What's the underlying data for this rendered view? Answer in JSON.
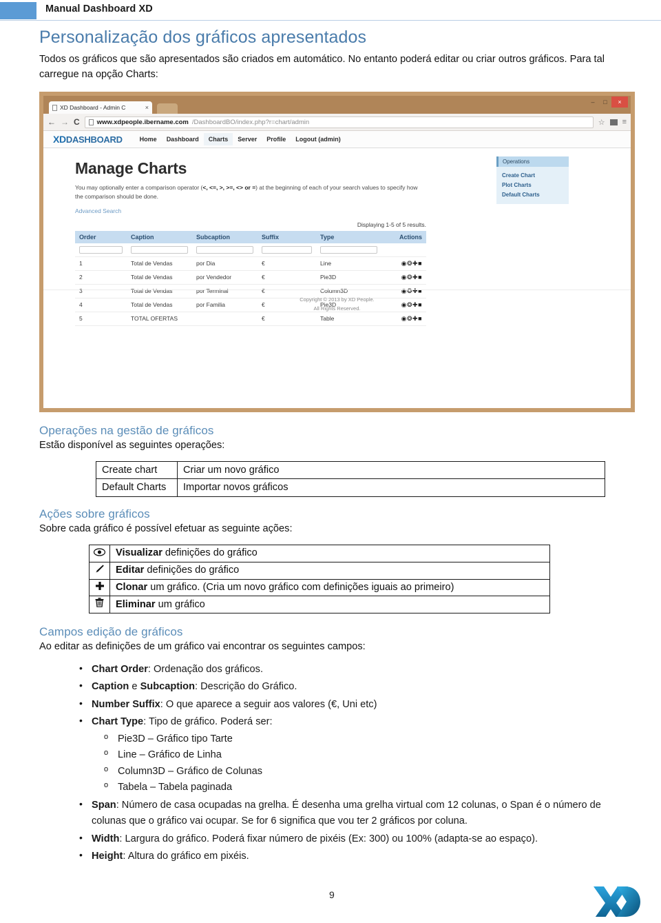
{
  "header": {
    "title": "Manual Dashboard XD",
    "swatch_color": "#5b9bd5"
  },
  "colors": {
    "heading": "#4a7cab",
    "subheading": "#5b8db8",
    "browser_frame": "#c69c6d",
    "logo": "#1f7fbe"
  },
  "sections": {
    "s1_title": "Personalização dos gráficos apresentados",
    "s1_para": "Todos os gráficos que são apresentados são criados em automático. No entanto poderá editar ou criar outros gráficos. Para tal carregue na opção Charts:",
    "s2_title": "Operações na gestão de gráficos",
    "s2_para": "Estão disponível as seguintes operações:",
    "s3_title": "Ações sobre gráficos",
    "s3_para": "Sobre cada gráfico é possível efetuar as seguinte ações:",
    "s4_title": "Campos edição de gráficos",
    "s4_para": "Ao editar as definições de um gráfico vai encontrar os seguintes campos:"
  },
  "browser": {
    "tab_title": "XD Dashboard - Admin C",
    "tab_close": "×",
    "win_minimize": "–",
    "win_maximize": "□",
    "win_close": "×",
    "back_icon": "←",
    "forward_icon": "→",
    "reload_icon": "C",
    "url_bold": "www.xdpeople.ibername.com",
    "url_rest": "/DashboardBO/index.php?r=chart/admin",
    "star_icon": "☆",
    "menu_icon": "≡"
  },
  "site": {
    "brand_xd": "XD",
    "brand_rest": "DASHBOARD",
    "nav": [
      {
        "label": "Home",
        "selected": false
      },
      {
        "label": "Dashboard",
        "selected": false
      },
      {
        "label": "Charts",
        "selected": true
      },
      {
        "label": "Server",
        "selected": false
      },
      {
        "label": "Profile",
        "selected": false
      },
      {
        "label": "Logout (admin)",
        "selected": false
      }
    ],
    "page_title": "Manage Charts",
    "hint_pre": "You may optionally enter a comparison operator (",
    "hint_ops": "<, <=, >, >=, <> or =",
    "hint_post": ") at the beginning of each of your search values to specify how the comparison should be done.",
    "advanced_search": "Advanced Search",
    "results_count": "Displaying 1-5 of 5 results.",
    "operations_panel": {
      "title": "Operations",
      "items": [
        "Create Chart",
        "Plot Charts",
        "Default Charts"
      ]
    },
    "table": {
      "columns": [
        "Order",
        "Caption",
        "Subcaption",
        "Suffix",
        "Type",
        "Actions"
      ],
      "rows": [
        {
          "order": "1",
          "caption": "Total de Vendas",
          "subcaption": "por Dia",
          "suffix": "€",
          "type": "Line"
        },
        {
          "order": "2",
          "caption": "Total de Vendas",
          "subcaption": "por Vendedor",
          "suffix": "€",
          "type": "Pie3D"
        },
        {
          "order": "3",
          "caption": "Total de Vendas",
          "subcaption": "por Terminal",
          "suffix": "€",
          "type": "Column3D"
        },
        {
          "order": "4",
          "caption": "Total de Vendas",
          "subcaption": "por Familia",
          "suffix": "€",
          "type": "Pie3D"
        },
        {
          "order": "5",
          "caption": "TOTAL OFERTAS",
          "subcaption": "",
          "suffix": "€",
          "type": "Table"
        }
      ],
      "row_actions": "◉ ╱ ✚ Ὕ1"
    },
    "footer_line1": "Copyright © 2013 by XD People.",
    "footer_line2": "All Rights Reserved."
  },
  "operations_table": {
    "rows": [
      {
        "key": "Create chart",
        "value": "Criar um novo gráfico"
      },
      {
        "key": "Default Charts",
        "value": "Importar novos gráficos"
      }
    ]
  },
  "actions_table": {
    "rows": [
      {
        "icon": "eye-icon",
        "glyph": "◉",
        "bold": "Visualizar",
        "rest": " definições do gráfico"
      },
      {
        "icon": "pencil-icon",
        "glyph": "╱",
        "bold": "Editar",
        "rest": " definições do gráfico"
      },
      {
        "icon": "plus-icon",
        "glyph": "✚",
        "bold": "Clonar",
        "rest": " um gráfico. (Cria um novo gráfico com definições iguais ao primeiro)"
      },
      {
        "icon": "trash-icon",
        "glyph": "Ὕ1",
        "bold": "Eliminar",
        "rest": " um gráfico"
      }
    ]
  },
  "fields_list": [
    {
      "bold": "Chart Order",
      "rest": ": Ordenação dos gráficos."
    },
    {
      "bold": "Caption",
      "mid": " e ",
      "bold2": "Subcaption",
      "rest": ": Descrição do Gráfico."
    },
    {
      "bold": "Number Suffix",
      "rest": ": O que aparece a seguir aos valores (€, Uni etc)"
    },
    {
      "bold": "Chart Type",
      "rest": ": Tipo de gráfico. Poderá ser:"
    },
    {
      "bold": "Span",
      "rest": ": Número de casa ocupadas na grelha. É desenha uma grelha virtual com 12 colunas, o Span é o número de colunas que o gráfico vai ocupar. Se for 6 significa que vou ter 2 gráficos por coluna."
    },
    {
      "bold": "Width",
      "rest": ": Largura do gráfico. Poderá fixar número de pixéis (Ex: 300) ou 100% (adapta-se ao espaço)."
    },
    {
      "bold": "Height",
      "rest": ": Altura do gráfico em pixéis."
    }
  ],
  "chart_types": [
    "Pie3D – Gráfico tipo Tarte",
    "Line – Gráfico de Linha",
    "Column3D – Gráfico de Colunas",
    "Tabela – Tabela paginada"
  ],
  "footer": {
    "page_number": "9"
  }
}
